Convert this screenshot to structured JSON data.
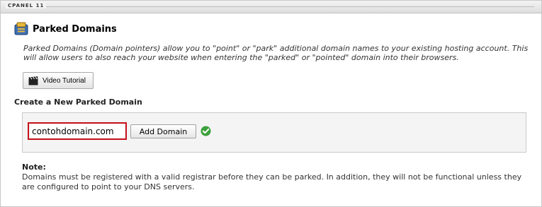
{
  "brand": "CPANEL 11",
  "page": {
    "title": "Parked Domains",
    "description": "Parked Domains (Domain pointers) allow you to \"point\" or \"park\" additional domain names to your existing hosting account. This will allow users to also reach your website when entering the \"parked\" or \"pointed\" domain into their browsers."
  },
  "video_tutorial": {
    "label": "Video Tutorial"
  },
  "create_section": {
    "title": "Create a New Parked Domain",
    "domain_value": "contohdomain.com",
    "add_button_label": "Add Domain"
  },
  "note": {
    "label": "Note:",
    "text": "Domains must be registered with a valid registrar before they can be parked. In addition, they will not be functional unless they are configured to point to your DNS servers."
  },
  "icons": {
    "title": "parked-domains-icon",
    "video": "clapperboard-icon",
    "status": "checkmark-icon"
  },
  "colors": {
    "highlight": "#c6121c",
    "check": "#3ca03c",
    "panel": "#f4f4f4"
  }
}
